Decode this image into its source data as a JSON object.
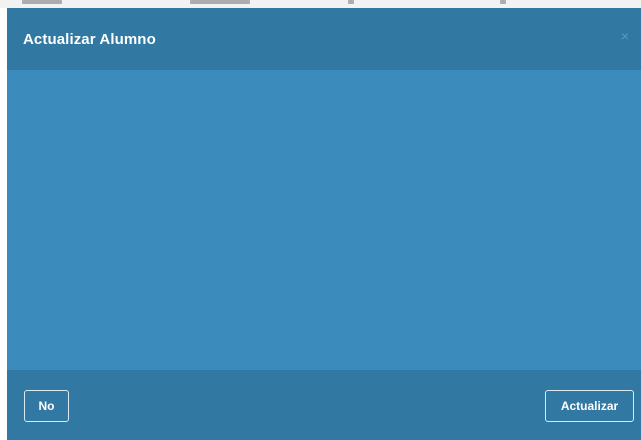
{
  "modal": {
    "title": "Actualizar Alumno",
    "close_glyph": "×",
    "footer": {
      "no_label": "No",
      "update_label": "Actualizar"
    }
  },
  "colors": {
    "header_bg": "#3178a3",
    "body_bg": "#3b8bbd",
    "footer_bg": "#3178a3",
    "text": "#ffffff"
  },
  "icons": {
    "close": "close-icon"
  }
}
